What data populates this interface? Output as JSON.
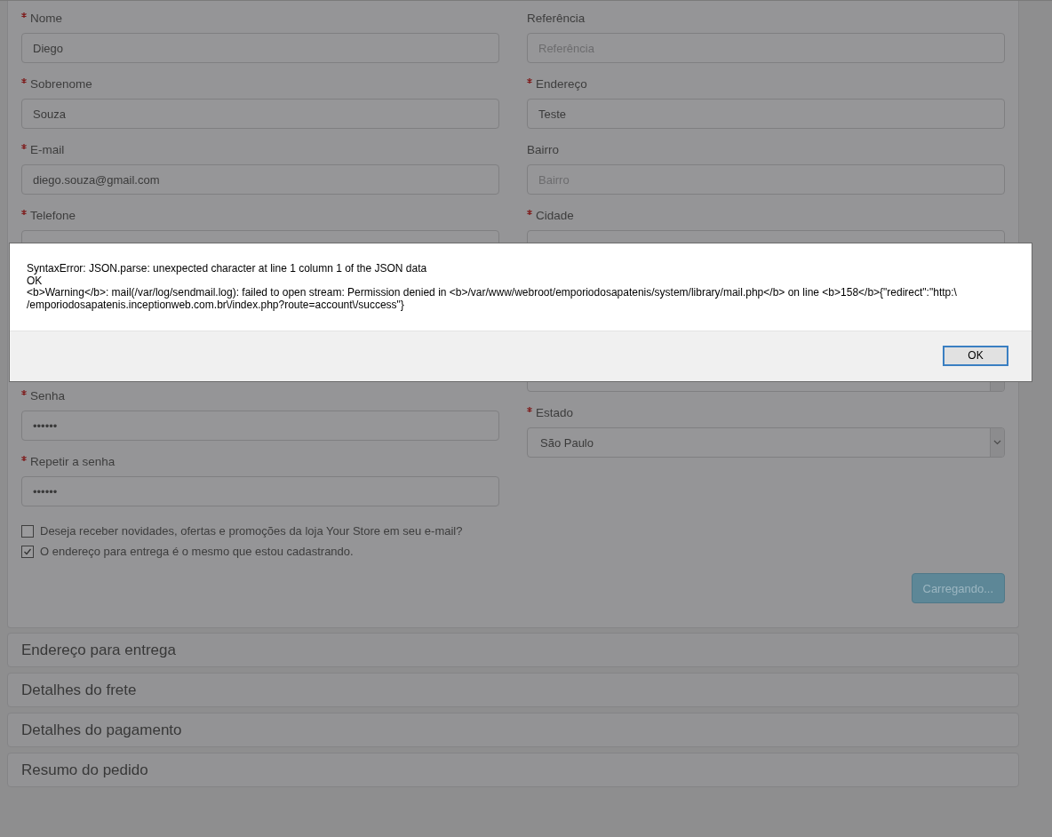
{
  "form": {
    "left_fields": [
      {
        "kind": "text",
        "label": "Nome",
        "required": true,
        "value": "Diego"
      },
      {
        "kind": "text",
        "label": "Sobrenome",
        "required": true,
        "value": "Souza"
      },
      {
        "kind": "text",
        "label": "E-mail",
        "required": true,
        "value": "diego.souza@gmail.com"
      },
      {
        "kind": "text",
        "label": "Telefone",
        "required": true
      },
      {
        "kind": "password",
        "label": "Senha",
        "required": true,
        "value": "••••••"
      },
      {
        "kind": "password",
        "label": "Repetir a senha",
        "required": true,
        "value": "••••••"
      }
    ],
    "right_fields": [
      {
        "kind": "text",
        "label": "Referência",
        "required": false,
        "placeholder": "Referência"
      },
      {
        "kind": "text",
        "label": "Endereço",
        "required": true,
        "value": "Teste"
      },
      {
        "kind": "text",
        "label": "Bairro",
        "required": false,
        "placeholder": "Bairro"
      },
      {
        "kind": "text",
        "label": "Cidade",
        "required": true
      },
      {
        "kind": "select"
      },
      {
        "kind": "select",
        "label": "Estado",
        "required": true,
        "value": "São Paulo"
      }
    ],
    "options": [
      {
        "label": "Deseja receber novidades, ofertas e promoções da loja Your Store em seu e-mail?",
        "checked": false
      },
      {
        "label": "O endereço para entrega é o mesmo que estou cadastrando.",
        "checked": true
      }
    ],
    "submit_button": {
      "label": "Carregando...",
      "disabled": true
    }
  },
  "sections": [
    {
      "title": "Endereço para entrega"
    },
    {
      "title": "Detalhes do frete"
    },
    {
      "title": "Detalhes do pagamento"
    },
    {
      "title": "Resumo do pedido"
    }
  ],
  "dialog": {
    "message_lines": [
      "SyntaxError: JSON.parse: unexpected character at line 1 column 1 of the JSON data",
      "OK",
      "<b>Warning</b>: mail(/var/log/sendmail.log): failed to open stream: Permission denied in <b>/var/www/webroot/emporiodosapatenis/system/library/mail.php</b> on line <b>158</b>{\"redirect\":\"http:\\",
      "/emporiodosapatenis.inceptionweb.com.br\\/index.php?route=account\\/success\"}"
    ],
    "button": "OK"
  }
}
